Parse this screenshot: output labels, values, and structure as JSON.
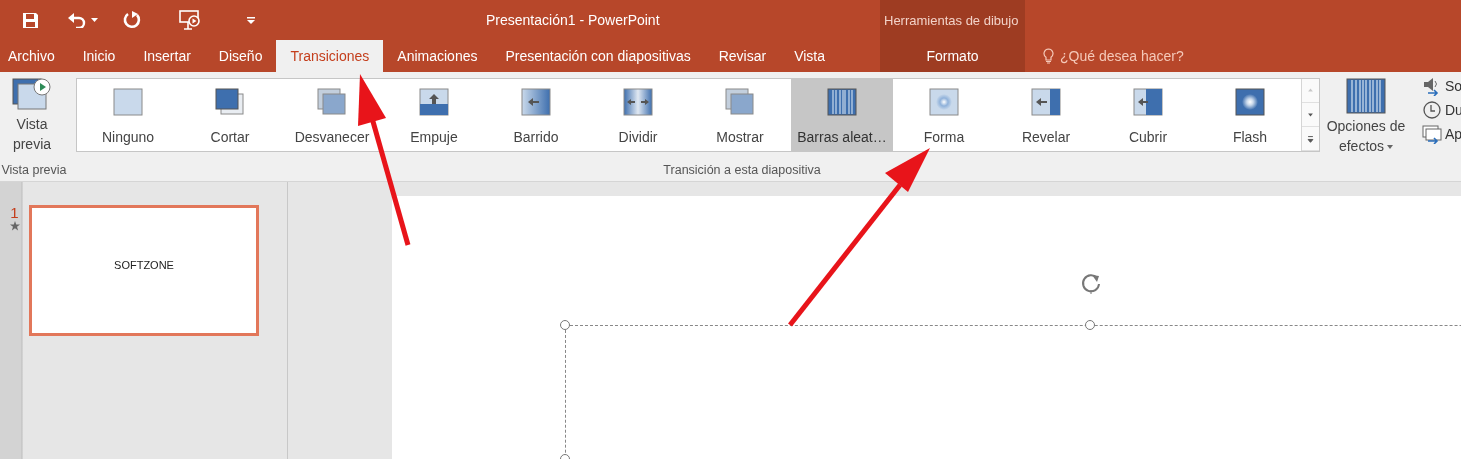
{
  "window": {
    "title": "Presentación1 - PowerPoint",
    "contextual_group": "Herramientas de dibujo"
  },
  "tabs": [
    {
      "label": "Archivo",
      "selected": false,
      "kind": "file"
    },
    {
      "label": "Inicio",
      "selected": false,
      "kind": "normal"
    },
    {
      "label": "Insertar",
      "selected": false,
      "kind": "normal"
    },
    {
      "label": "Diseño",
      "selected": false,
      "kind": "normal"
    },
    {
      "label": "Transiciones",
      "selected": true,
      "kind": "normal"
    },
    {
      "label": "Animaciones",
      "selected": false,
      "kind": "normal"
    },
    {
      "label": "Presentación con diapositivas",
      "selected": false,
      "kind": "normal"
    },
    {
      "label": "Revisar",
      "selected": false,
      "kind": "normal"
    },
    {
      "label": "Vista",
      "selected": false,
      "kind": "normal"
    },
    {
      "label": "Formato",
      "selected": false,
      "kind": "contextual"
    }
  ],
  "tell_me": {
    "placeholder": "¿Qué desea hacer?"
  },
  "ribbon": {
    "preview_group": {
      "button": "Vista previa",
      "label": "Vista previa"
    },
    "transition_group": {
      "label": "Transición a esta diapositiva",
      "effect_options": "Opciones de efectos",
      "gallery": [
        {
          "label": "Ninguno",
          "selected": false
        },
        {
          "label": "Cortar",
          "selected": false
        },
        {
          "label": "Desvanecer",
          "selected": false
        },
        {
          "label": "Empuje",
          "selected": false
        },
        {
          "label": "Barrido",
          "selected": false
        },
        {
          "label": "Dividir",
          "selected": false
        },
        {
          "label": "Mostrar",
          "selected": false
        },
        {
          "label": "Barras aleat…",
          "selected": true
        },
        {
          "label": "Forma",
          "selected": false
        },
        {
          "label": "Revelar",
          "selected": false
        },
        {
          "label": "Cubrir",
          "selected": false
        },
        {
          "label": "Flash",
          "selected": false
        }
      ]
    },
    "timing_group": {
      "items": [
        "So",
        "Du",
        "Ap"
      ]
    }
  },
  "slides": [
    {
      "number": "1",
      "text": "SOFTZONE",
      "selected": true,
      "has_transition": true
    }
  ]
}
